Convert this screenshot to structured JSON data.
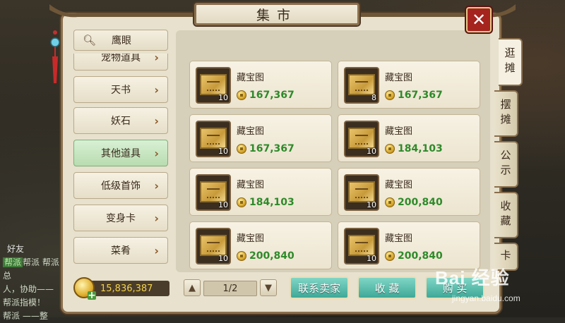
{
  "title": "集市",
  "search": {
    "label": "鹰眼"
  },
  "categories": [
    {
      "label": "宠物道具"
    },
    {
      "label": "天书"
    },
    {
      "label": "妖石"
    },
    {
      "label": "其他道具"
    },
    {
      "label": "低级首饰"
    },
    {
      "label": "变身卡"
    },
    {
      "label": "菜肴"
    }
  ],
  "items": [
    {
      "name": "藏宝图",
      "qty": "10",
      "price": "167,367"
    },
    {
      "name": "藏宝图",
      "qty": "8",
      "price": "167,367"
    },
    {
      "name": "藏宝图",
      "qty": "10",
      "price": "167,367"
    },
    {
      "name": "藏宝图",
      "qty": "10",
      "price": "184,103"
    },
    {
      "name": "藏宝图",
      "qty": "10",
      "price": "184,103"
    },
    {
      "name": "藏宝图",
      "qty": "10",
      "price": "200,840"
    },
    {
      "name": "藏宝图",
      "qty": "10",
      "price": "200,840"
    },
    {
      "name": "藏宝图",
      "qty": "10",
      "price": "200,840"
    }
  ],
  "side_tabs": [
    {
      "label": "逛摊"
    },
    {
      "label": "摆摊"
    },
    {
      "label": "公示"
    },
    {
      "label": "收藏"
    },
    {
      "label": "卡"
    }
  ],
  "money": "15,836,387",
  "pager": {
    "page": "1/2"
  },
  "actions": {
    "contact_seller": "联系卖家",
    "favorite": "收 藏",
    "buy": "购 买"
  },
  "background_chat": {
    "friends": "好友",
    "lines": [
      "帮派 帮派总",
      "人，协助——",
      "帮派指模！",
      "帮派 ——整"
    ]
  },
  "watermark": {
    "main": "Bai 经验",
    "sub": "jingyan.baidu.com"
  },
  "colors": {
    "price_green": "#2e8a2a",
    "money_yellow": "#f2d24a",
    "action_teal": "#3fa897",
    "close_red": "#a5241e"
  }
}
